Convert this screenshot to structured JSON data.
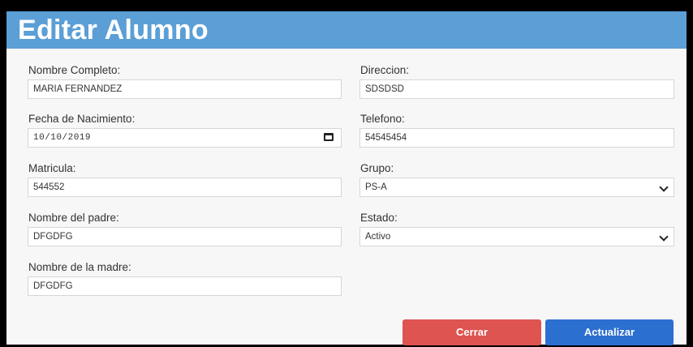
{
  "header": {
    "title": "Editar Alumno"
  },
  "fields": {
    "nombre_completo": {
      "label": "Nombre Completo:",
      "value": "MARIA FERNANDEZ"
    },
    "fecha_nacimiento": {
      "label": "Fecha de Nacimiento:",
      "value": "10/10/2019"
    },
    "matricula": {
      "label": "Matricula:",
      "value": "544552"
    },
    "nombre_padre": {
      "label": "Nombre del padre:",
      "value": "DFGDFG"
    },
    "nombre_madre": {
      "label": "Nombre de la madre:",
      "value": "DFGDFG"
    },
    "direccion": {
      "label": "Direccion:",
      "value": "SDSDSD"
    },
    "telefono": {
      "label": "Telefono:",
      "value": "54545454"
    },
    "grupo": {
      "label": "Grupo:",
      "value": "PS-A"
    },
    "estado": {
      "label": "Estado:",
      "value": "Activo"
    }
  },
  "buttons": {
    "cerrar": "Cerrar",
    "actualizar": "Actualizar"
  },
  "colors": {
    "header": "#5b9fd6",
    "cerrar": "#dd5450",
    "actualizar": "#2b6fd1"
  },
  "icons": {
    "date": "calendar-icon",
    "select": "chevron-down-icon"
  }
}
